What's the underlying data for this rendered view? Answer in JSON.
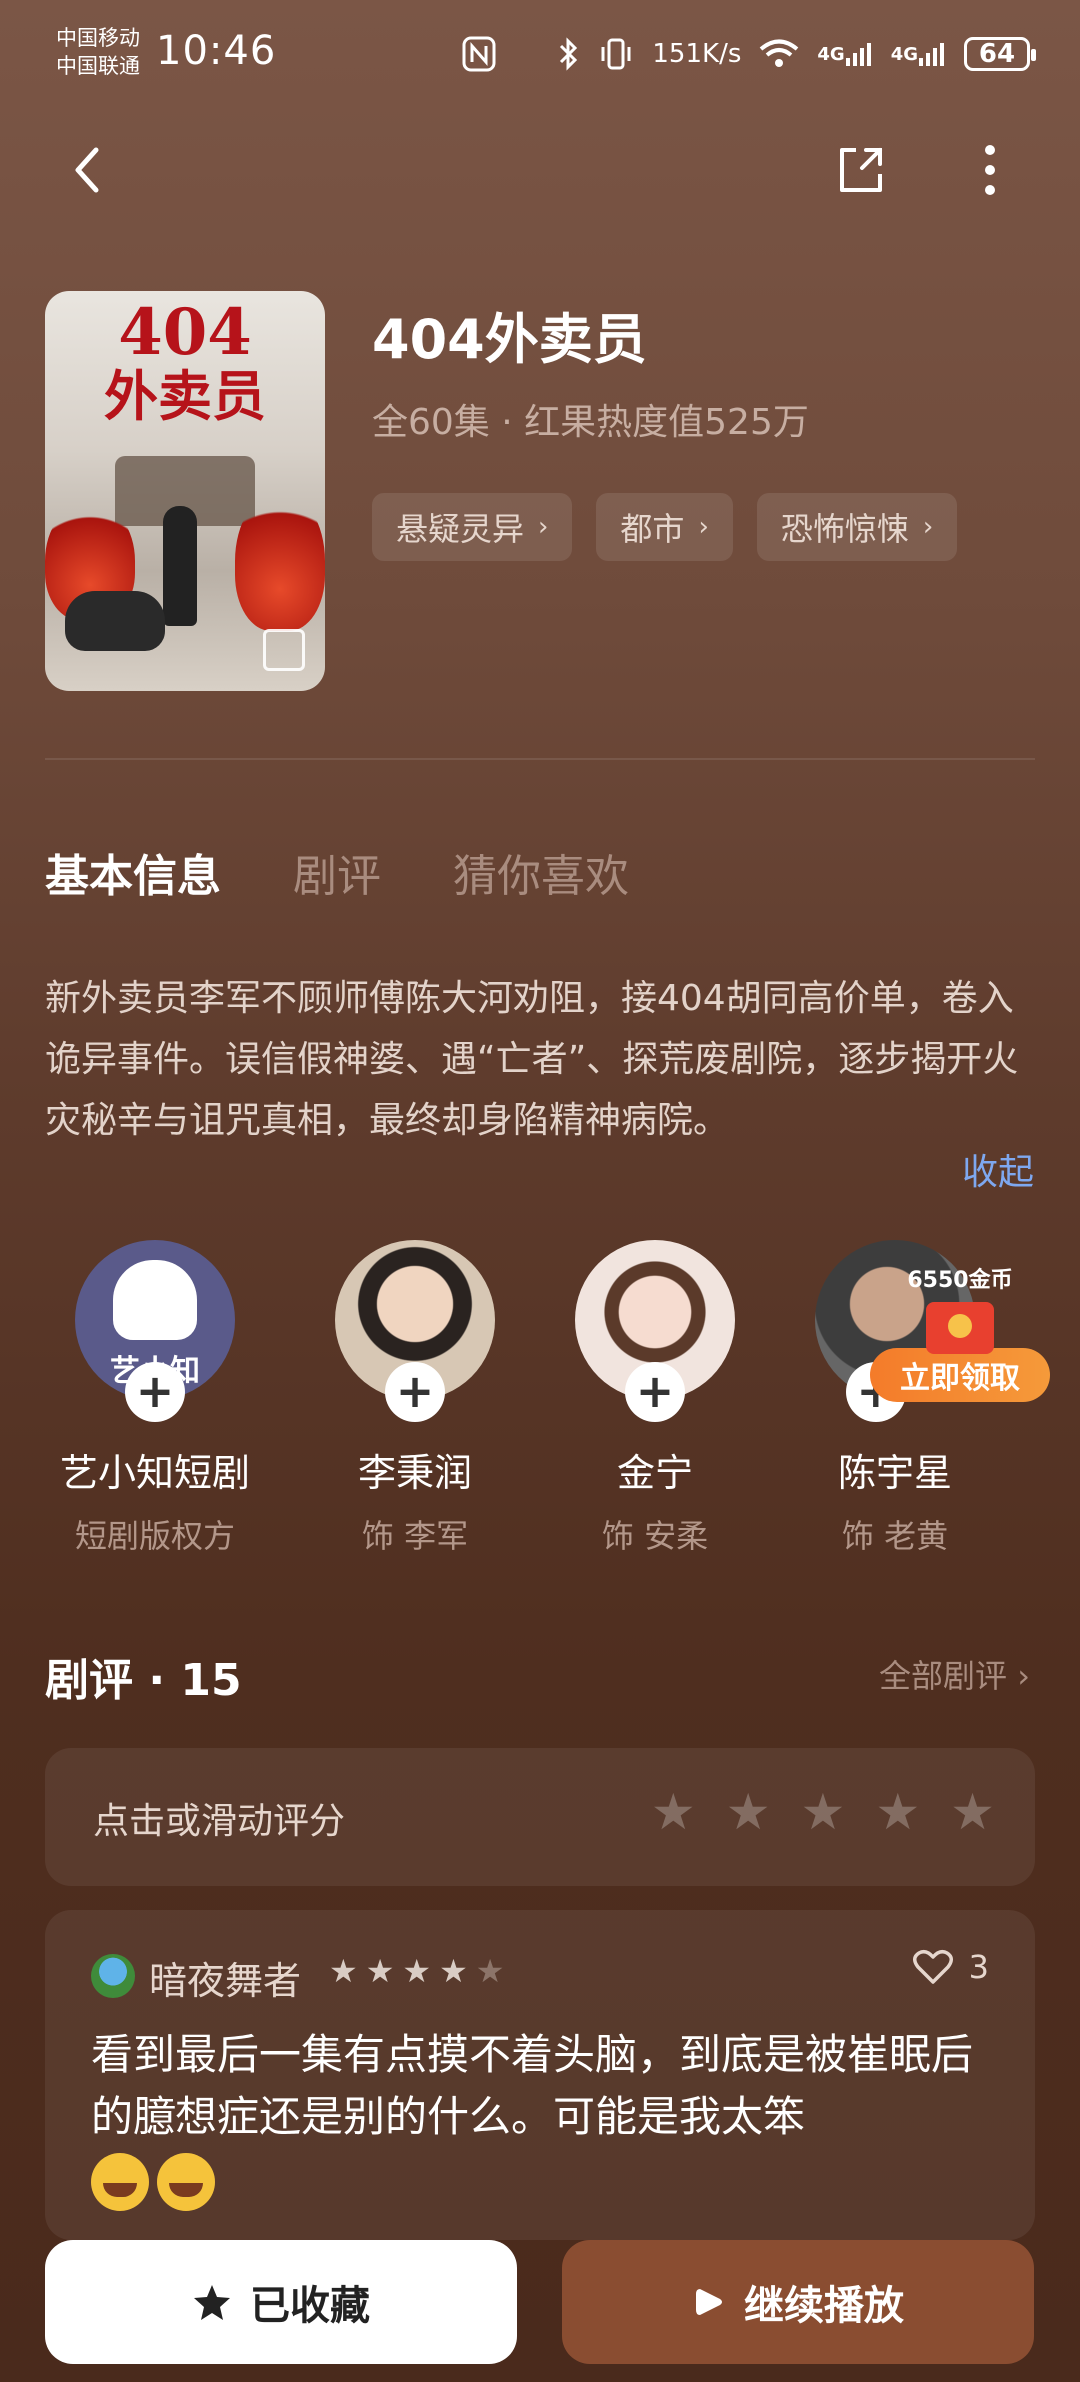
{
  "status_bar": {
    "carrier1": "中国移动",
    "carrier2": "中国联通",
    "time": "10:46",
    "net_speed_top": "151",
    "net_speed_bottom": "K/s",
    "signal1": "4G",
    "signal2": "4G",
    "battery": "64"
  },
  "drama": {
    "title": "404外卖员",
    "meta": "全60集 · 红果热度值525万",
    "tags": [
      "悬疑灵异",
      "都市",
      "恐怖惊悚"
    ],
    "cover_text_num": "404",
    "cover_text_title": "外卖员"
  },
  "tabs": [
    "基本信息",
    "剧评",
    "猜你喜欢"
  ],
  "synopsis": "新外卖员李军不顾师傅陈大河劝阻，接404胡同高价单，卷入诡异事件。误信假神婆、遇“亡者”、探荒废剧院，逐步揭开火灾秘辛与诅咒真相，最终却身陷精神病院。",
  "collapse_label": "收起",
  "cast": [
    {
      "name": "艺小知短剧",
      "role": "短剧版权方",
      "avatar_text": "艺小知"
    },
    {
      "name": "李秉润",
      "role": "饰 李军"
    },
    {
      "name": "金宁",
      "role": "饰 安柔"
    },
    {
      "name": "陈宇星",
      "role": "饰 老黄"
    }
  ],
  "reward": {
    "coins": "6550金币",
    "button": "立即领取"
  },
  "reviews": {
    "title": "剧评 · 15",
    "all_label": "全部剧评",
    "rate_prompt": "点击或滑动评分",
    "items": [
      {
        "user": "暗夜舞者",
        "rating": 4.5,
        "likes": "3",
        "text": "看到最后一集有点摸不着头脑，到底是被崔眠后的臆想症还是别的什么。可能是我太笨"
      }
    ]
  },
  "actions": {
    "favorite": "已收藏",
    "play": "继续播放"
  },
  "colors": {
    "accent_link": "#7ea8f0",
    "play_button": "#8a4d31",
    "reward_orange": "#f47b2a"
  }
}
